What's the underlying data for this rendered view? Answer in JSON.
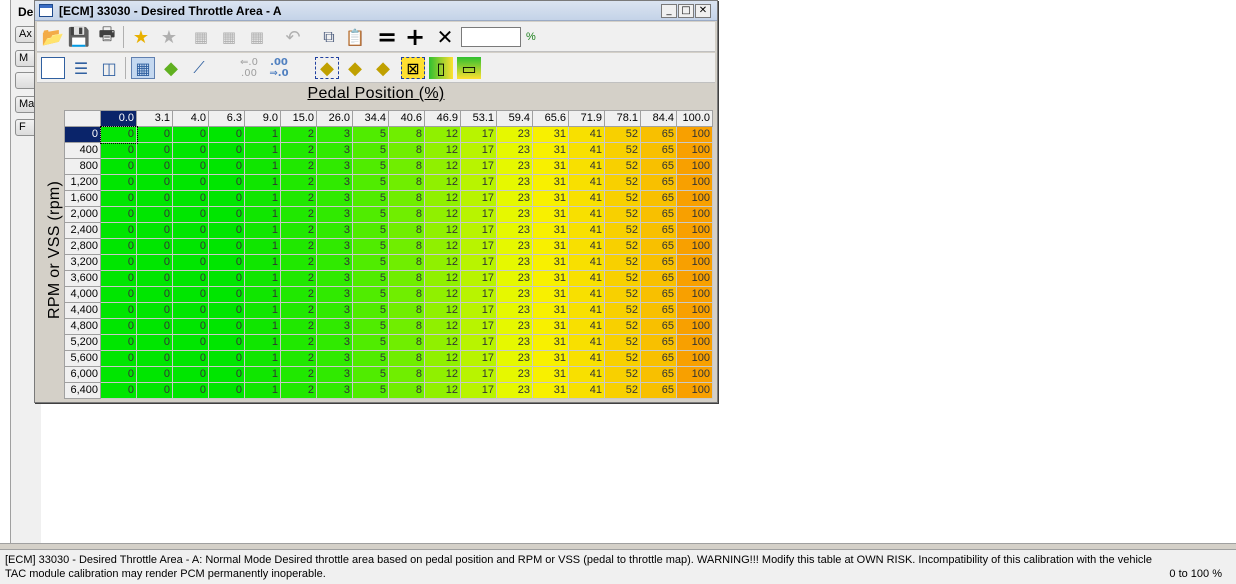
{
  "background": {
    "panel_label": "De",
    "buttons": [
      "Ax",
      "M",
      "",
      "Ma",
      "F"
    ]
  },
  "window": {
    "title": "[ECM] 33030 - Desired Throttle Area - A",
    "controls": {
      "minimize": "_",
      "maximize": "□",
      "close": "✕"
    }
  },
  "toolbar1": {
    "icons": [
      "open-folder-icon",
      "save-icon",
      "print-icon",
      "add-favorite-icon",
      "remove-favorite-icon",
      "table-icon",
      "table-icon-2",
      "table-icon-3",
      "undo-icon",
      "copy-icon",
      "paste-icon",
      "equals-icon",
      "plus-icon",
      "multiply-icon"
    ],
    "operator_input_value": "",
    "unit": "%"
  },
  "toolbar2": {
    "icons": [
      "single-view-icon",
      "horizontal-split-icon",
      "vertical-split-icon",
      "grid-view-icon",
      "3d-surface-icon",
      "line-graph-icon",
      "decrease-decimal-icon",
      "increase-decimal-icon",
      "surface-select-icon",
      "surface-left-icon",
      "surface-down-icon",
      "fill-select-icon",
      "fill-vertical-icon",
      "fill-horizontal-icon"
    ],
    "decrease_decimal_top": "⇐.0",
    "decrease_decimal_bottom": ".00",
    "increase_decimal_top": ".00",
    "increase_decimal_bottom": "⇒.0"
  },
  "table": {
    "x_axis_label": "Pedal Position (%)",
    "y_axis_label": "RPM or VSS (rpm)",
    "columns": [
      "0.0",
      "3.1",
      "4.0",
      "6.3",
      "9.0",
      "15.0",
      "26.0",
      "34.4",
      "40.6",
      "46.9",
      "53.1",
      "59.4",
      "65.6",
      "71.9",
      "78.1",
      "84.4",
      "100.0"
    ],
    "rows": [
      "0",
      "400",
      "800",
      "1,200",
      "1,600",
      "2,000",
      "2,400",
      "2,800",
      "3,200",
      "3,600",
      "4,000",
      "4,400",
      "4,800",
      "5,200",
      "5,600",
      "6,000",
      "6,400"
    ],
    "row_values": [
      0,
      0,
      0,
      0,
      1,
      2,
      3,
      5,
      8,
      12,
      17,
      23,
      31,
      41,
      52,
      65,
      100
    ],
    "col_colors": [
      "#00e600",
      "#00e600",
      "#00e600",
      "#00e600",
      "#10e600",
      "#20e800",
      "#30ea00",
      "#50ec00",
      "#70ee00",
      "#90f000",
      "#b8f400",
      "#e6f800",
      "#f8f000",
      "#f8e000",
      "#f8d000",
      "#f8c000",
      "#f8a000"
    ]
  },
  "status": {
    "description": "[ECM] 33030 - Desired Throttle Area - A: Normal Mode Desired throttle area based on pedal position and RPM or VSS (pedal to throttle map). WARNING!!! Modify this table at OWN RISK. Incompatibility of this calibration with the vehicle TAC module calibration may render PCM permanently inoperable.",
    "range": "0 to 100 %"
  }
}
